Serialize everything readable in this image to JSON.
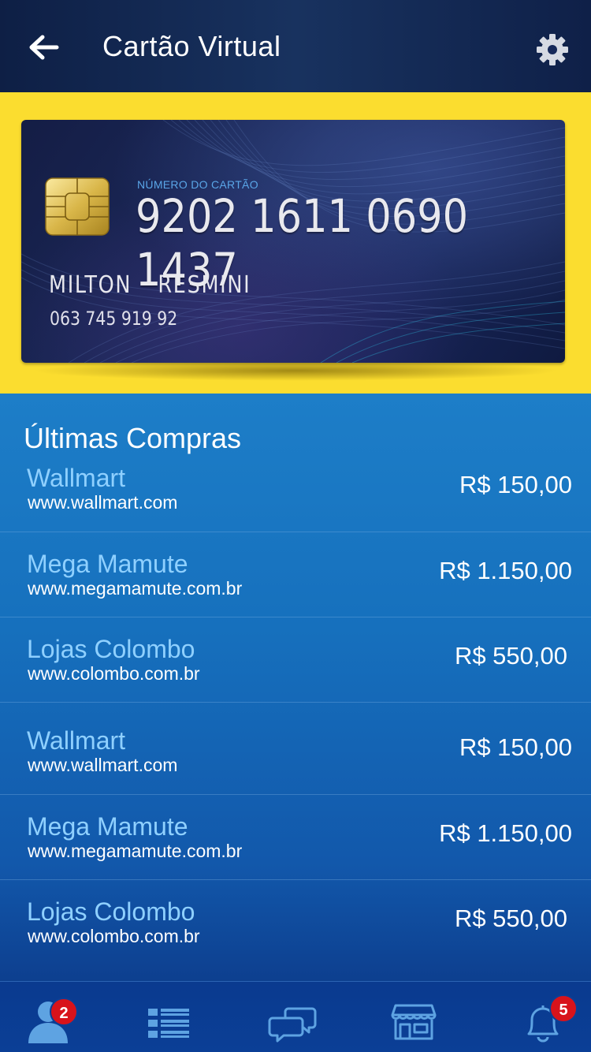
{
  "header": {
    "title": "Cartão Virtual",
    "back_icon": "arrow-left-icon",
    "settings_icon": "gear-icon"
  },
  "card": {
    "number_label": "NÚMERO DO CARTÃO",
    "number": "9202 1611 0690 1437",
    "holder_name": "MILTON  RESMINI",
    "document": "063 745 919 92"
  },
  "purchases": {
    "title": "Últimas Compras",
    "items": [
      {
        "store": "Wallmart",
        "url": "www.wallmart.com",
        "amount": "R$ 150,00"
      },
      {
        "store": "Mega Mamute",
        "url": "www.megamamute.com.br",
        "amount": "R$ 1.150,00"
      },
      {
        "store": "Lojas Colombo",
        "url": "www.colombo.com.br",
        "amount": "R$ 550,00"
      },
      {
        "store": "Wallmart",
        "url": "www.wallmart.com",
        "amount": "R$ 150,00"
      },
      {
        "store": "Mega Mamute",
        "url": "www.megamamute.com.br",
        "amount": "R$ 1.150,00"
      },
      {
        "store": "Lojas Colombo",
        "url": "www.colombo.com.br",
        "amount": "R$ 550,00"
      }
    ]
  },
  "nav": {
    "items": [
      {
        "icon": "user-icon",
        "badge": "2"
      },
      {
        "icon": "list-icon"
      },
      {
        "icon": "chat-icon"
      },
      {
        "icon": "store-icon"
      },
      {
        "icon": "bell-icon",
        "badge": "5"
      }
    ]
  },
  "colors": {
    "header_bg": "#13295a",
    "accent_yellow": "#fbdd2f",
    "list_bg": "#1670bd",
    "store_name": "#8fd0ff",
    "badge": "#d8131b"
  }
}
